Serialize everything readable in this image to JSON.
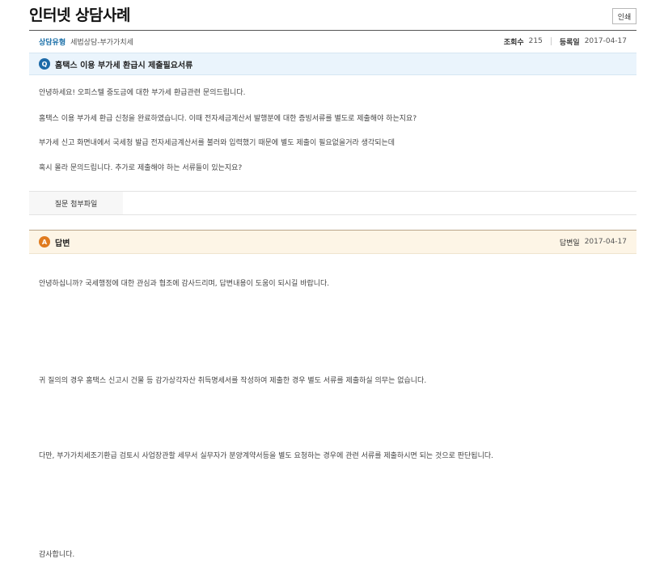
{
  "header": {
    "title": "인터넷 상담사례",
    "print_label": "인쇄"
  },
  "meta": {
    "type_label": "상담유형",
    "type_value": "세법상담-부가가치세",
    "views_label": "조회수",
    "views_value": "215",
    "date_label": "등록일",
    "date_value": "2017-04-17"
  },
  "question": {
    "badge": "Q",
    "title": "홈택스 이용 부가세 환급시 제출필요서류",
    "lines": [
      "안녕하세요! 오피스텔 중도금에 대한 부가세 환급관련 문의드립니다.",
      "홈택스 이용 부가세 환급 신청을 완료하였습니다. 이때 전자세금계산서 발행분에 대한 증빙서류를 별도로 제출해야 하는지요?",
      "부가세 신고 화면내에서 국세청 발급 전자세금계산서를 불러와 입력했기 때문에 별도 제출이 필요없을거라 생각되는데",
      "혹시 몰라 문의드립니다. 추가로 제출해야 하는 서류들이 있는지요?"
    ],
    "attachment_label": "질문 첨부파일"
  },
  "answer": {
    "badge": "A",
    "title": "답변",
    "date_label": "답변일",
    "date_value": "2017-04-17",
    "lines": [
      "안녕하십니까? 국세행정에 대한 관심과 협조에 감사드리며, 답변내용이 도움이 되시길 바랍니다.",
      "귀 질의의 경우 홈택스 신고시 건물 등 감가상각자산 취득명세서를 작성하여 제출한 경우 별도 서류를 제출하실 의무는 없습니다.",
      "다만, 부가가치세조기환급 검토시 사업장관할 세무서 실무자가 분양계약서등을 별도 요청하는 경우에 관련 서류를 제출하시면 되는 것으로 판단됩니다.",
      "감사합니다."
    ]
  }
}
